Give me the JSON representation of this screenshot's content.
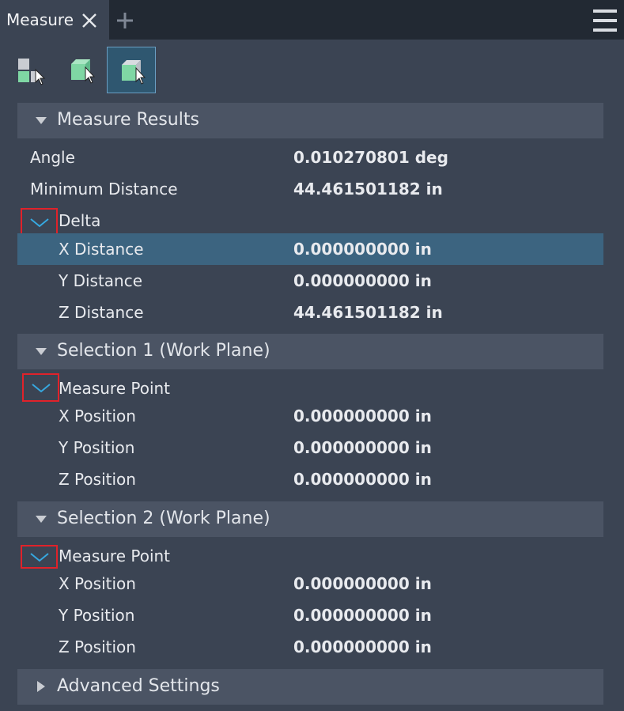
{
  "tab": {
    "title": "Measure"
  },
  "toolbar": {
    "tools": [
      {
        "name": "select-component-tool",
        "active": false
      },
      {
        "name": "select-face-tool",
        "active": false
      },
      {
        "name": "select-body-tool",
        "active": true
      }
    ]
  },
  "colors": {
    "accent": "#3c6480",
    "highlight_box": "#e0222a",
    "chevron": "#36a8e0"
  },
  "measure_results": {
    "title": "Measure Results",
    "angle_label": "Angle",
    "angle_value": "0.010270801 deg",
    "min_distance_label": "Minimum Distance",
    "min_distance_value": "44.461501182 in",
    "delta": {
      "label": "Delta",
      "x_label": "X Distance",
      "x_value": "0.000000000 in",
      "y_label": "Y Distance",
      "y_value": "0.000000000 in",
      "z_label": "Z Distance",
      "z_value": "44.461501182 in"
    }
  },
  "selection1": {
    "title": "Selection 1 (Work Plane)",
    "point_label": "Measure Point",
    "x_label": "X Position",
    "x_value": "0.000000000 in",
    "y_label": "Y Position",
    "y_value": "0.000000000 in",
    "z_label": "Z Position",
    "z_value": "0.000000000 in"
  },
  "selection2": {
    "title": "Selection 2 (Work Plane)",
    "point_label": "Measure Point",
    "x_label": "X Position",
    "x_value": "0.000000000 in",
    "y_label": "Y Position",
    "y_value": "0.000000000 in",
    "z_label": "Z Position",
    "z_value": "0.000000000 in"
  },
  "advanced": {
    "title": "Advanced Settings"
  }
}
